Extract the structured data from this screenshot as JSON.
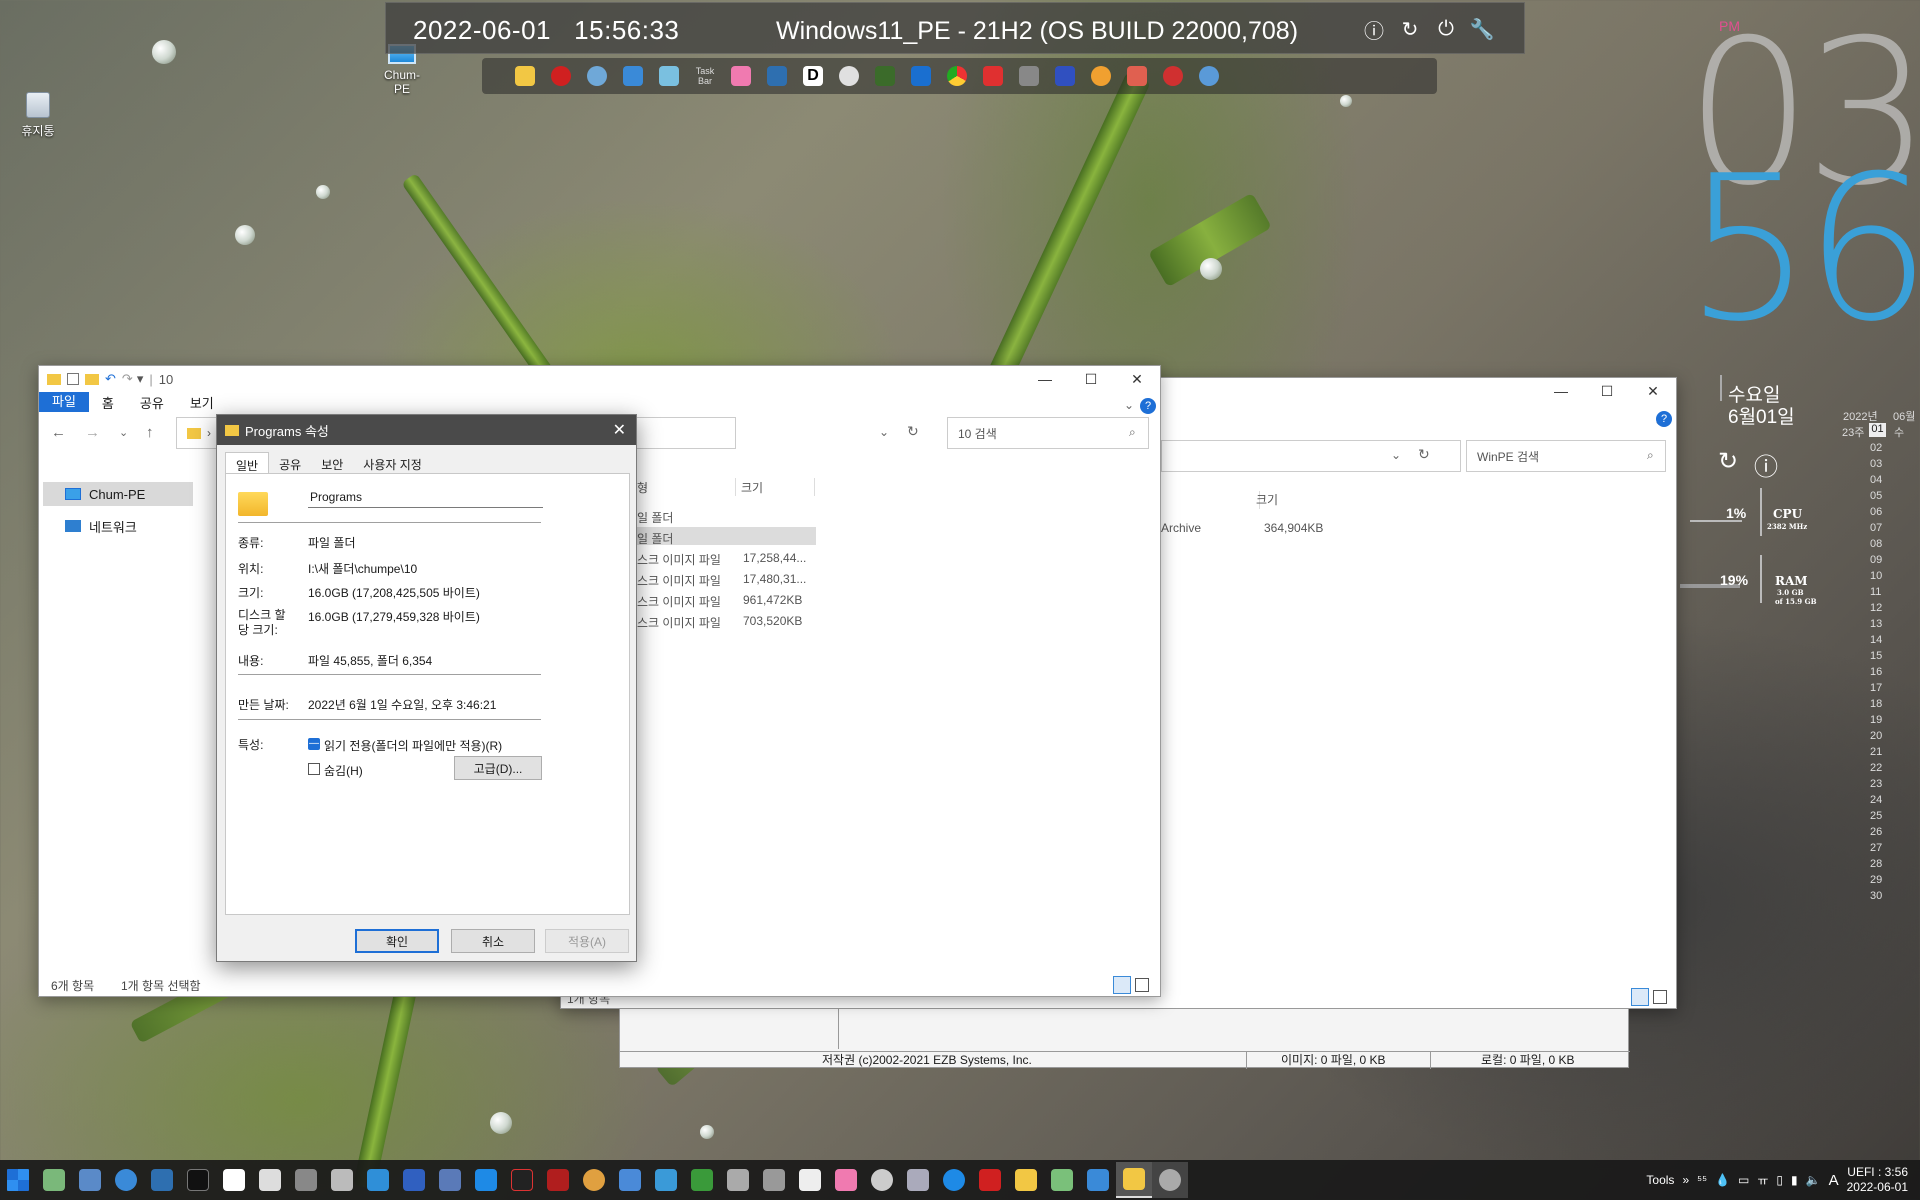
{
  "desktop": {
    "recycle_label": "휴지통",
    "pc_label": "Chum-PE"
  },
  "topbar": {
    "date": "2022-06-01",
    "time": "15:56:33",
    "os": "Windows11_PE - 21H2 (OS BUILD 22000,708)",
    "taskbar_label": "Task\nBar"
  },
  "clock": {
    "ampm": "PM",
    "hour": "03",
    "minute": "56",
    "weekday": "수요일",
    "date": "6월01일",
    "cpu_pct": "1%",
    "cpu_label": "CPU",
    "cpu_freq": "2382 MHz",
    "ram_pct": "19%",
    "ram_label": "RAM",
    "ram_used": "3.0 GB",
    "ram_total": "of 15.9 GB"
  },
  "calendar": {
    "year": "2022년",
    "month": "06월",
    "week": "23주",
    "first_day": "01",
    "first_weekday": "수",
    "days": [
      "02",
      "03",
      "04",
      "05",
      "06",
      "07",
      "08",
      "09",
      "10",
      "11",
      "12",
      "13",
      "14",
      "15",
      "16",
      "17",
      "18",
      "19",
      "20",
      "21",
      "22",
      "23",
      "24",
      "25",
      "26",
      "27",
      "28",
      "29",
      "30"
    ]
  },
  "explorer_back": {
    "search_placeholder": "WinPE 검색",
    "col_size": "크기",
    "row_type": "Archive",
    "row_size": "364,904KB",
    "status": "1개 항목",
    "statusbar": {
      "copyright": "저작권 (c)2002-2021 EZB Systems, Inc.",
      "image": "이미지: 0 파일, 0 KB",
      "local": "로컬: 0 파일, 0 KB"
    }
  },
  "explorer_front": {
    "title": "10",
    "ribbon": [
      "파일",
      "홈",
      "공유",
      "보기"
    ],
    "search_placeholder": "10 검색",
    "nav": [
      "Chum-PE",
      "네트워크"
    ],
    "col_type": "형",
    "col_size": "크기",
    "rows": [
      {
        "type": "일 폴더",
        "size": ""
      },
      {
        "type": "일 폴더",
        "size": ""
      },
      {
        "type": "스크 이미지 파일",
        "size": "17,258,44..."
      },
      {
        "type": "스크 이미지 파일",
        "size": "17,480,31..."
      },
      {
        "type": "스크 이미지 파일",
        "size": "961,472KB"
      },
      {
        "type": "스크 이미지 파일",
        "size": "703,520KB"
      }
    ],
    "status_count": "6개 항목",
    "status_selected": "1개 항목 선택함"
  },
  "dialog": {
    "title": "Programs 속성",
    "tabs": [
      "일반",
      "공유",
      "보안",
      "사용자 지정"
    ],
    "name": "Programs",
    "type_label": "종류:",
    "type_value": "파일 폴더",
    "location_label": "위치:",
    "location_value": "I:\\새 폴더\\chumpe\\10",
    "size_label": "크기:",
    "size_value": "16.0GB (17,208,425,505 바이트)",
    "disk_label": "디스크 할\n당 크기:",
    "disk_value": "16.0GB (17,279,459,328 바이트)",
    "contents_label": "내용:",
    "contents_value": "파일 45,855, 폴더 6,354",
    "created_label": "만든 날짜:",
    "created_value": "2022년 6월 1일 수요일, 오후 3:46:21",
    "attr_label": "특성:",
    "readonly_label": "읽기 전용(폴더의 파일에만 적용)(R)",
    "hidden_label": "숨김(H)",
    "advanced_label": "고급(D)...",
    "ok_label": "확인",
    "cancel_label": "취소",
    "apply_label": "적용(A)"
  },
  "taskbar": {
    "tools_label": "Tools",
    "uefi_time": "UEFI : 3:56",
    "date": "2022-06-01"
  }
}
